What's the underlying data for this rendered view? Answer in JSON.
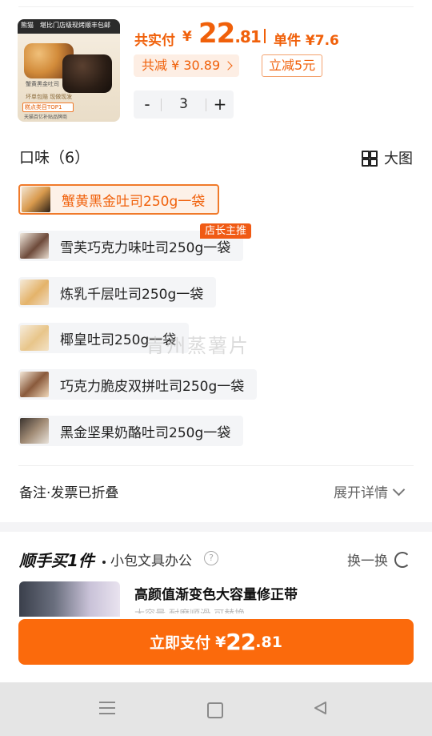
{
  "product": {
    "thumb_brand": "熊猫",
    "thumb_brand_sub": "堪比门店级现烤",
    "thumb_badge_right": "顺丰包邮",
    "thumb_caption": "蟹黄黑金吐司",
    "thumb_ship": "坏单包赔 现做现发",
    "thumb_tag": "糕点类目TOP1",
    "thumb_sub_tag": "天猫百亿补贴品牌商",
    "total_label": "共实付",
    "total_currency": "¥",
    "total_int": "22",
    "total_dec": ".81",
    "unit_price_label": "单件 ¥7.6",
    "save_text": "共减 ¥ 30.89",
    "instant_discount": "立减5元",
    "quantity": "3",
    "minus": "-",
    "plus": "+"
  },
  "flavor": {
    "title": "口味（6）",
    "big_view_label": "大图",
    "options": [
      {
        "label": "蟹黄黑金吐司250g一袋",
        "selected": true
      },
      {
        "label": "雪芙巧克力味吐司250g一袋",
        "selected": false
      },
      {
        "label": "炼乳千层吐司250g一袋",
        "selected": false
      },
      {
        "label": "椰皇吐司250g一袋",
        "selected": false
      },
      {
        "label": "巧克力脆皮双拼吐司250g一袋",
        "selected": false
      },
      {
        "label": "黑金坚果奶酪吐司250g一袋",
        "selected": false
      }
    ],
    "badge": "店长主推",
    "watermark": "青州蒸薯片"
  },
  "notes": {
    "label": "备注·发票已折叠",
    "expand_label": "展开详情"
  },
  "buy_together": {
    "title": "顺手买1件",
    "subtitle": "小包文具办公",
    "help": "?",
    "swap_label": "换一换",
    "item_title": "高颜值渐变色大容量修正带",
    "item_faded": "大容量 耐磨顺滑 可替换"
  },
  "pay": {
    "label": "立即支付",
    "currency": "¥",
    "amount_int": "22",
    "amount_dec": ".81"
  },
  "colors": {
    "accent": "#f0600a",
    "pay_button": "#fb6a0c",
    "badge": "#f05a14"
  },
  "icons": [
    "grid-icon",
    "chevron-right-icon",
    "chevron-down-icon",
    "help-icon",
    "refresh-icon",
    "menu-icon",
    "home-icon",
    "back-icon"
  ]
}
